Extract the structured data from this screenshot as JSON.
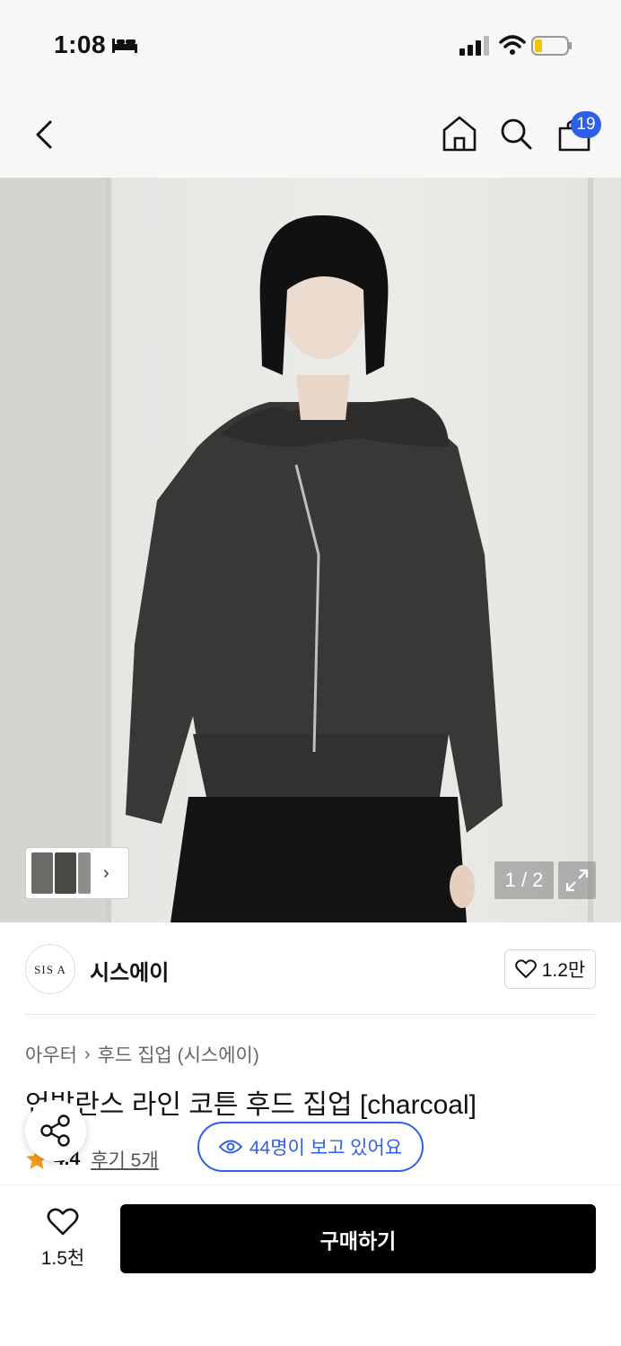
{
  "status_bar": {
    "time": "1:08"
  },
  "nav": {
    "cart_count": "19",
    "icons": [
      "back-icon",
      "home-icon",
      "search-icon",
      "shopping-bag-icon"
    ]
  },
  "gallery": {
    "page_indicator": "1 / 2"
  },
  "brand": {
    "logo_text": "SIS A",
    "name": "시스에이",
    "like_count": "1.2만"
  },
  "product": {
    "breadcrumb": [
      "아우터",
      "후드 집업 (시스에이)"
    ],
    "title": "언발란스 라인 코튼 후드 집업 [charcoal]",
    "rating": "4.4",
    "reviews_label": "후기 5개",
    "viewers_label": "44명이 보고 있어요"
  },
  "bottom_bar": {
    "wish_count": "1.5천",
    "buy_label": "구매하기"
  },
  "colors": {
    "accent": "#2f5fe8",
    "star": "#f29b1e",
    "buy_button": "#000000"
  }
}
